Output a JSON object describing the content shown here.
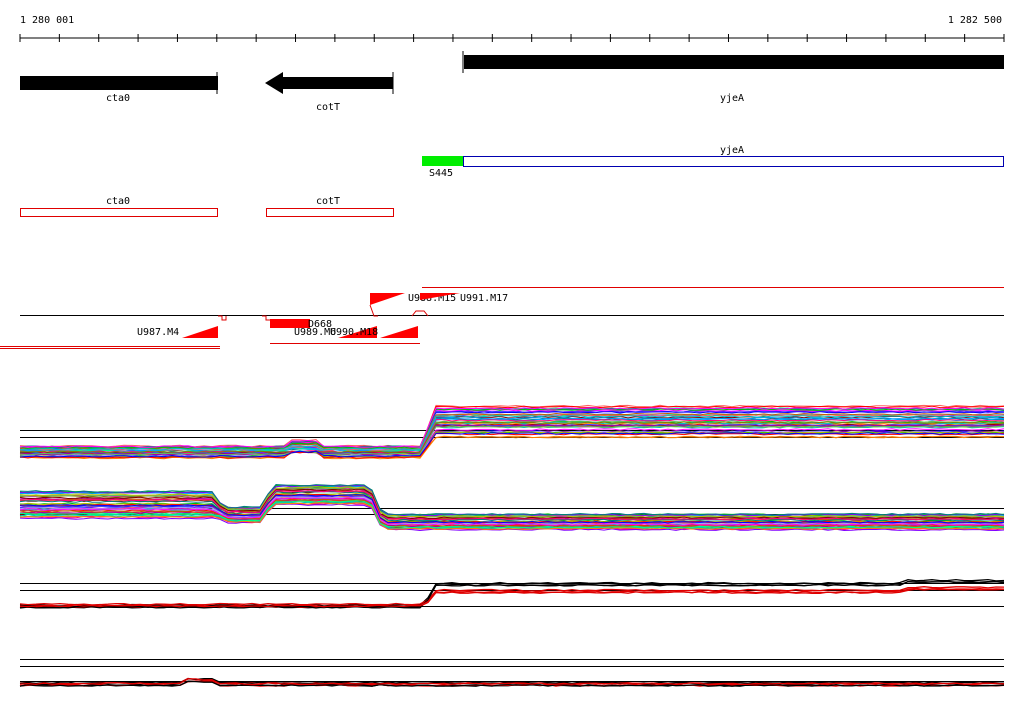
{
  "ruler": {
    "start_label": "1 280 001",
    "end_label": "1 282 500"
  },
  "genes": [
    {
      "id": "gene-cta0",
      "label": "cta0"
    },
    {
      "id": "gene-cott",
      "label": "cotT"
    },
    {
      "id": "gene-yjea",
      "label": "yjeA"
    }
  ],
  "annotation_track": {
    "yjea_label": "yjeA",
    "s445_label": "S445",
    "cta0_label": "cta0",
    "cott_label": "cotT"
  },
  "segments": {
    "u987": "U987.M4",
    "d668": "D668",
    "u989": "U989.M6",
    "u990": "U990.M18",
    "u988": "U988.M15",
    "u991": "U991.M17"
  },
  "colors": {
    "gene_fill": "#000000",
    "annotation_outline_red": "#e00000",
    "annotation_outline_blue": "#0000b0",
    "s445_fill": "#00ee00",
    "segment_red": "#ff0000",
    "axis_black": "#000000"
  },
  "expression_palette": [
    "#ff0000",
    "#00c000",
    "#0000ff",
    "#ff00ff",
    "#00c0c0",
    "#c0c000",
    "#ff8000",
    "#8000ff",
    "#008080",
    "#800000",
    "#00ff80",
    "#ff0080",
    "#4040ff",
    "#808000",
    "#00a0ff",
    "#a000a0",
    "#60c060",
    "#ff6060",
    "#a0a0ff",
    "#c06000"
  ]
}
